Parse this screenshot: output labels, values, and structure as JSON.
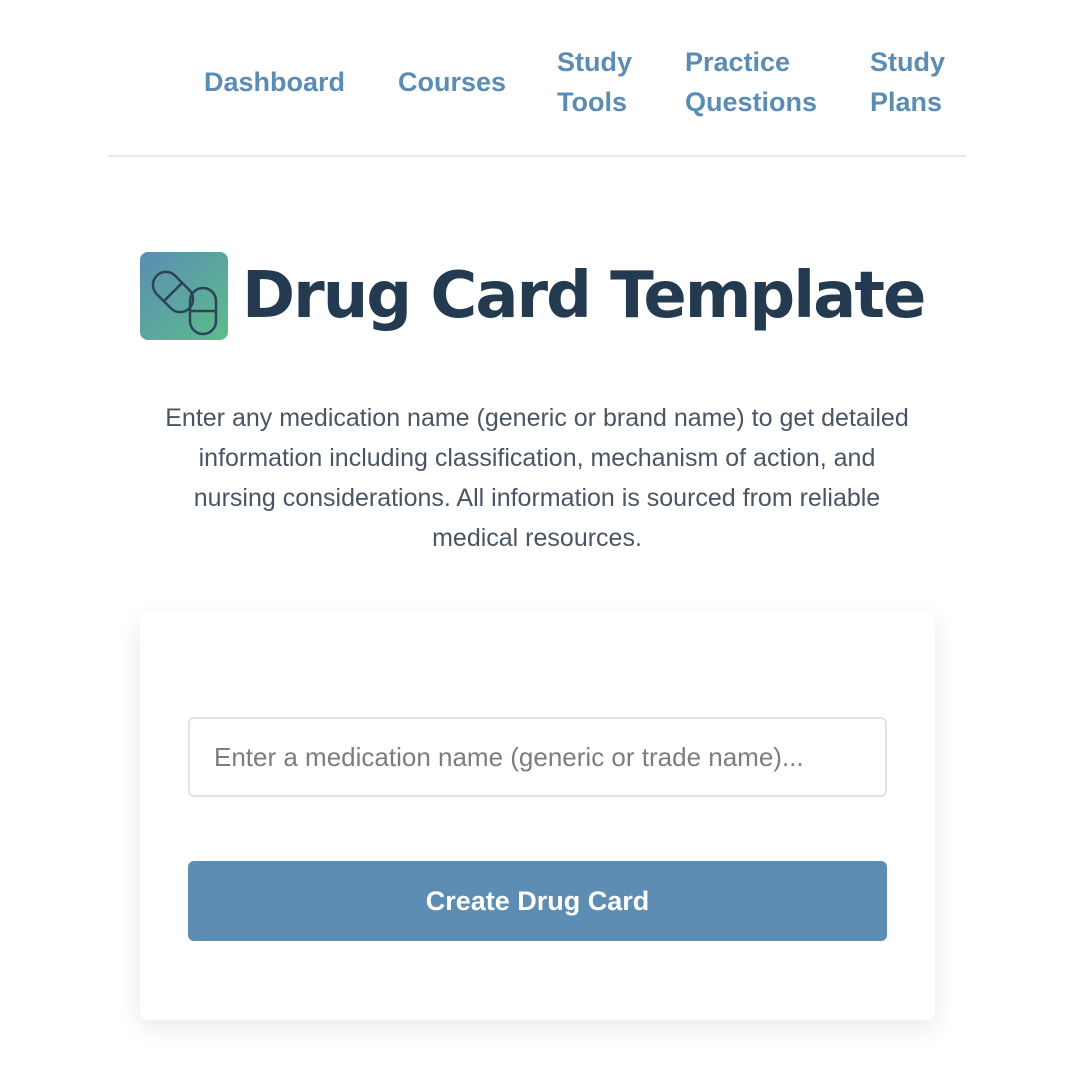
{
  "nav": {
    "dashboard": "Dashboard",
    "courses": "Courses",
    "study_tools": [
      "Study",
      "Tools"
    ],
    "practice_questions": [
      "Practice",
      "Questions"
    ],
    "study_plans": [
      "Study",
      "Plans"
    ]
  },
  "header": {
    "logo_icon": "capsule-pills-icon",
    "title": "Drug Card Template"
  },
  "intro": {
    "description": "Enter any medication name (generic or brand name) to get detailed information including classification, mechanism of action, and nursing considerations. All information is sourced from reliable medical resources."
  },
  "form": {
    "input_placeholder": "Enter a medication name (generic or trade name)...",
    "input_value": "",
    "submit_label": "Create Drug Card"
  },
  "colors": {
    "nav_link": "#5b8db4",
    "title": "#233a50",
    "button": "#5e8db3",
    "logo_gradient_start": "#5b8db4",
    "logo_gradient_end": "#5dbd8a"
  }
}
